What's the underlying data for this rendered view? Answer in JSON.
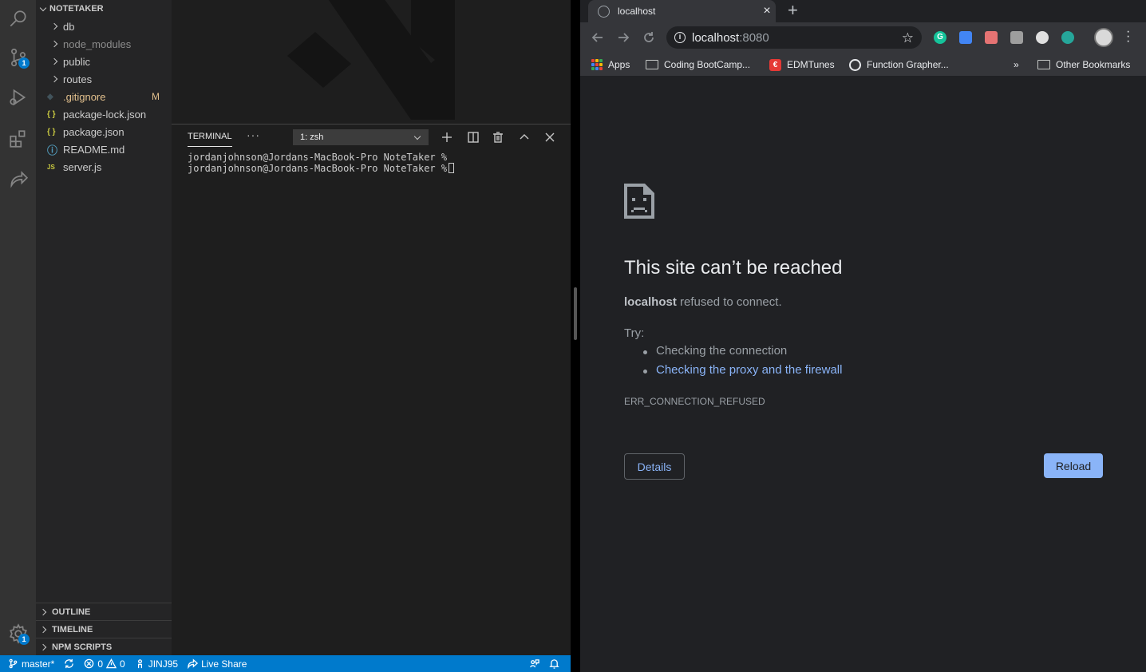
{
  "vscode": {
    "explorer": {
      "title": "NOTETAKER",
      "folders": [
        {
          "label": "db"
        },
        {
          "label": "node_modules"
        },
        {
          "label": "public"
        },
        {
          "label": "routes"
        }
      ],
      "files": [
        {
          "label": ".gitignore",
          "icon": "◆",
          "status": "M"
        },
        {
          "label": "package-lock.json",
          "icon": "{ }"
        },
        {
          "label": "package.json",
          "icon": "{ }"
        },
        {
          "label": "README.md",
          "icon": "ⓘ"
        },
        {
          "label": "server.js",
          "icon": "JS"
        }
      ],
      "sections": [
        "OUTLINE",
        "TIMELINE",
        "NPM SCRIPTS"
      ]
    },
    "activity_badges": {
      "source_control": "1",
      "settings": "1"
    },
    "terminal": {
      "tab_title": "TERMINAL",
      "more": "···",
      "selected_shell": "1: zsh",
      "lines": [
        "jordanjohnson@Jordans-MacBook-Pro NoteTaker %",
        "jordanjohnson@Jordans-MacBook-Pro NoteTaker %"
      ]
    },
    "statusbar": {
      "branch": "master*",
      "errors": "0",
      "warnings": "0",
      "user": "JINJ95",
      "live_share": "Live Share"
    },
    "colors": {
      "statusbar": "#007acc",
      "activity_bar": "#333333",
      "sidebar": "#252526"
    }
  },
  "chrome": {
    "tab": {
      "title": "localhost",
      "close": "×"
    },
    "newtab": "+",
    "address": {
      "host": "localhost",
      "port": ":8080",
      "star": "☆"
    },
    "bookmarks": {
      "apps": "Apps",
      "items": [
        "Coding BootCamp...",
        "EDMTunes",
        "Function Grapher..."
      ],
      "overflow": "»",
      "other": "Other Bookmarks"
    },
    "error": {
      "title": "This site can’t be reached",
      "host": "localhost",
      "message": "refused to connect.",
      "try_label": "Try:",
      "suggestions": [
        "Checking the connection",
        "Checking the proxy and the firewall"
      ],
      "code": "ERR_CONNECTION_REFUSED",
      "details_button": "Details",
      "reload_button": "Reload"
    },
    "colors": {
      "page_bg": "#202124",
      "link": "#8ab4f8",
      "toolbar": "#35363a"
    }
  }
}
